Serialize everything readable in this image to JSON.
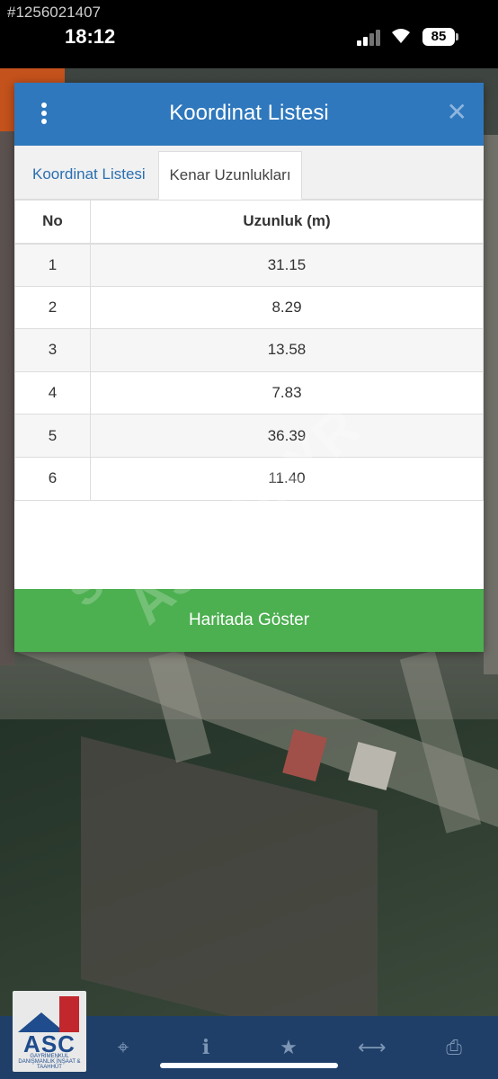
{
  "status_bar": {
    "watermark_id": "#1256021407",
    "time": "18:12",
    "battery": "85"
  },
  "modal": {
    "title": "Koordinat Listesi",
    "tabs": [
      {
        "label": "Koordinat Listesi",
        "active": false
      },
      {
        "label": "Kenar Uzunlukları",
        "active": true
      }
    ],
    "table": {
      "headers": [
        "No",
        "Uzunluk (m)"
      ],
      "rows": [
        [
          "1",
          "31.15"
        ],
        [
          "2",
          "8.29"
        ],
        [
          "3",
          "13.58"
        ],
        [
          "4",
          "7.83"
        ],
        [
          "5",
          "36.39"
        ],
        [
          "6",
          "11.40"
        ]
      ]
    },
    "show_button": "Haritada Göster"
  },
  "overlay_watermark": [
    "satis",
    "ASC GAYR"
  ],
  "toolbar": {
    "logo_text": "ASC",
    "logo_subtext": "GAYRİMENKUL DANIŞMANLIK İNŞAAT & TAAHHÜT",
    "icons": [
      "crosshair-icon",
      "info-icon",
      "star-icon",
      "measure-icon",
      "print-icon"
    ]
  },
  "colors": {
    "header": "#2f78bd",
    "button": "#4caf50",
    "toolbar": "#1f3f68",
    "active_tab_text": "#2a6fb0"
  }
}
